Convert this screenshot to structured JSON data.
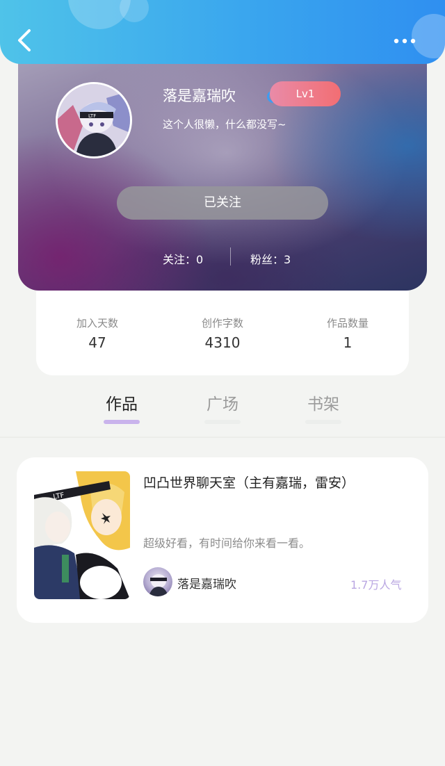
{
  "header": {
    "back_icon": "chevron-left-icon",
    "more_icon": "more-horizontal-icon"
  },
  "profile": {
    "username": "落是嘉瑞吹",
    "gender_icon": "male-icon",
    "level": "Lv1",
    "bio": "这个人很懒，什么都没写~",
    "follow_button": "已关注",
    "following": "关注：0",
    "fans": "粉丝：3"
  },
  "stats": [
    {
      "label": "加入天数",
      "value": "47"
    },
    {
      "label": "创作字数",
      "value": "4310"
    },
    {
      "label": "作品数量",
      "value": "1"
    }
  ],
  "tabs": [
    {
      "label": "作品",
      "active": true
    },
    {
      "label": "广场",
      "active": false
    },
    {
      "label": "书架",
      "active": false
    }
  ],
  "works": [
    {
      "title": "凹凸世界聊天室（主有嘉瑞，雷安）",
      "description": "超级好看，有时间给你来看一看。",
      "author": "落是嘉瑞吹",
      "popularity": "1.7万人气"
    }
  ],
  "colors": {
    "header_start": "#4fc3e9",
    "header_end": "#2f8ff0",
    "level_badge": "#f26e73",
    "gender": "#3d9df2",
    "active_tab_bar": "#c9b3ec",
    "popularity": "#b9a6e2"
  }
}
